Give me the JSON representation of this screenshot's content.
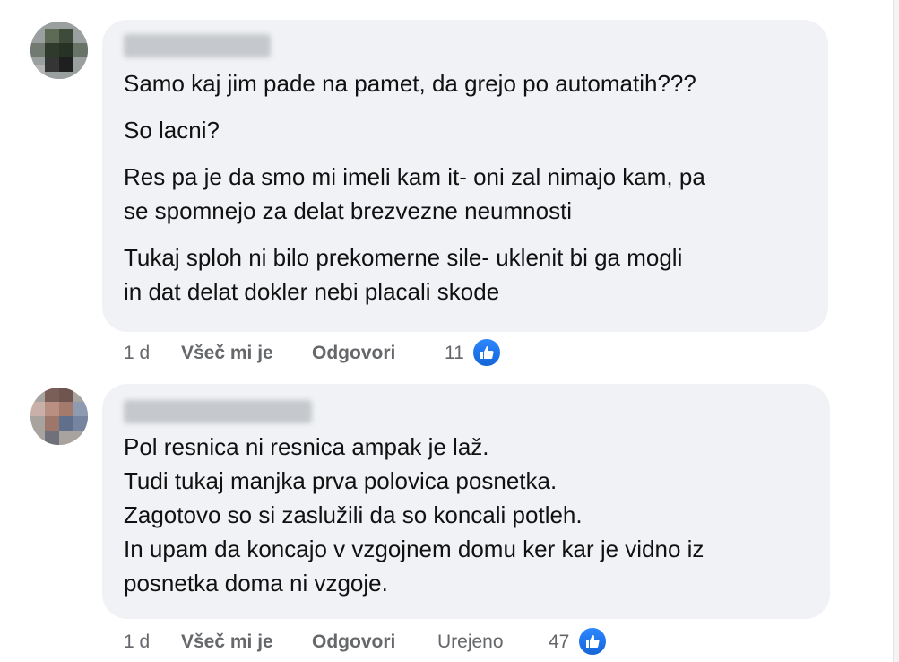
{
  "comments": [
    {
      "author": "",
      "paragraphs": [
        "Samo kaj jim pade na pamet, da grejo po automatih???",
        "So lacni?",
        "Res pa je da smo mi imeli kam it- oni zal nimajo kam, pa\nse spomnejo za delat brezvezne neumnosti",
        "Tukaj sploh ni bilo prekomerne sile- uklenit bi ga mogli\nin dat delat dokler nebi placali skode"
      ],
      "time": "1 d",
      "like_label": "Všeč mi je",
      "reply_label": "Odgovori",
      "reaction_count": "11",
      "reaction_icon": "like-icon",
      "accent_color": "#1877f2"
    },
    {
      "author": "",
      "lines": [
        "Pol resnica ni resnica ampak je laž.",
        "Tudi tukaj manjka prva polovica posnetka.",
        "Zagotovo so si zaslužili da so koncali potleh.",
        "In upam da koncajo v vzgojnem domu ker kar je vidno iz",
        "posnetka doma ni vzgoje."
      ],
      "time": "1 d",
      "like_label": "Všeč mi je",
      "reply_label": "Odgovori",
      "edited_label": "Urejeno",
      "reaction_count": "47",
      "reaction_icon": "like-icon",
      "accent_color": "#1877f2"
    }
  ],
  "colors": {
    "bubble": "#f0f2f5",
    "text": "#050505",
    "meta": "#65676b",
    "like_blue": "#1877f2"
  }
}
